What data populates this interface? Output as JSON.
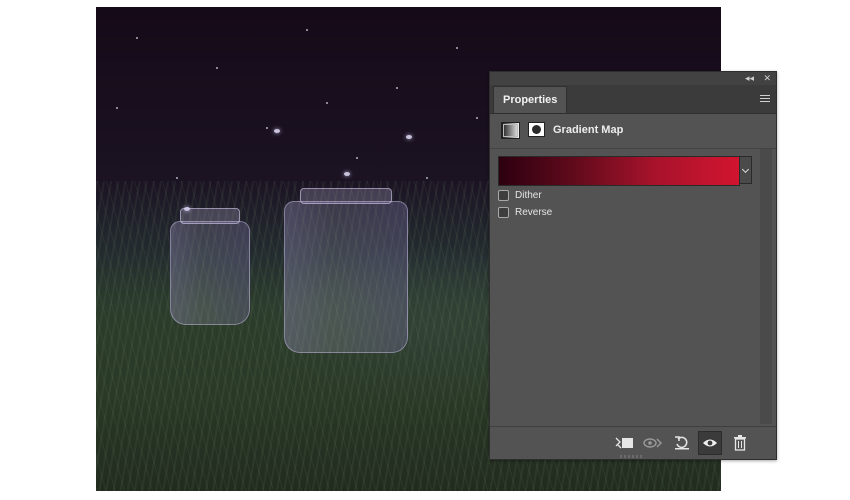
{
  "panel": {
    "tab_label": "Properties",
    "header_title": "Gradient Map",
    "gradient": {
      "start_color": "#2d0010",
      "mid_color": "#a8132b",
      "end_color": "#d2142f"
    },
    "options": [
      {
        "label": "Dither",
        "checked": false
      },
      {
        "label": "Reverse",
        "checked": false
      }
    ],
    "titlebar": {
      "collapse_glyph": "◂◂",
      "close_glyph": "✕"
    },
    "footer_icons": [
      "clip-to-layer-icon",
      "view-previous-state-icon",
      "reset-icon",
      "visibility-eye-icon",
      "delete-icon"
    ]
  }
}
